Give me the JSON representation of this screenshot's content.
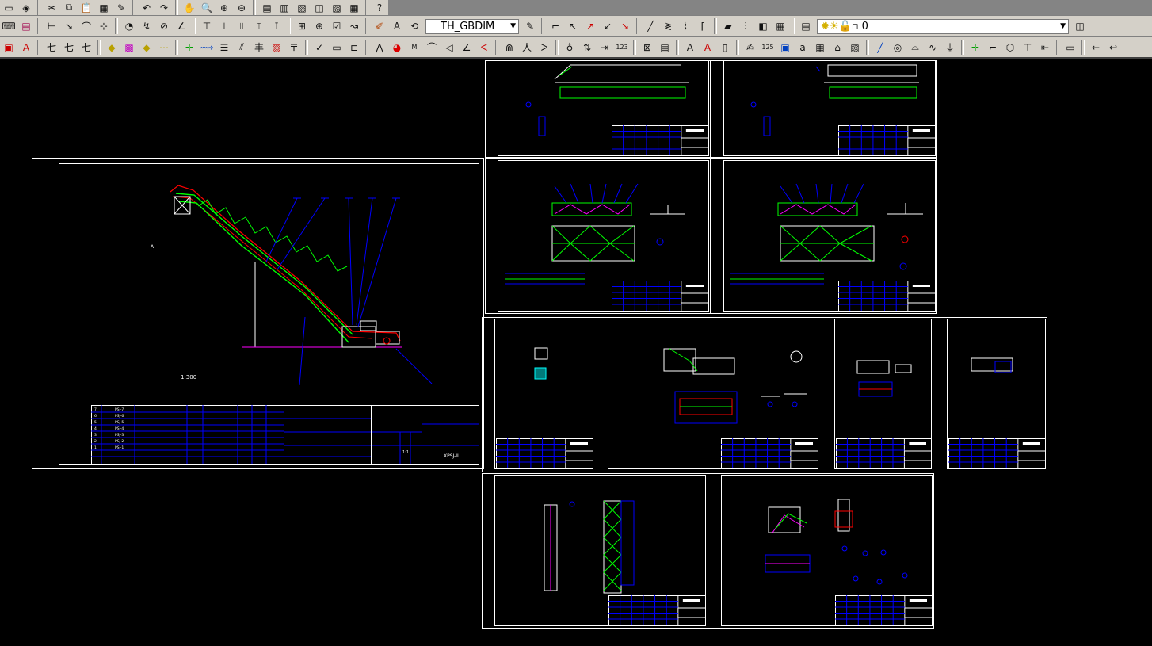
{
  "toolbar_top": {
    "icons": [
      "new-icon",
      "open-icon",
      "cut-icon",
      "copy-icon",
      "paste-icon",
      "match-properties-icon",
      "brush-icon",
      "undo-icon",
      "redo-icon",
      "pan-icon",
      "zoom-realtime-icon",
      "zoom-window-icon",
      "zoom-previous-icon",
      "properties-icon",
      "design-center-icon",
      "tool-palettes-icon",
      "sheet-set-icon",
      "markup-icon",
      "quick-calc-icon",
      "help-icon"
    ]
  },
  "toolbar_dim": {
    "dimstyle_value": "TH_GBDIM",
    "layer_value": "0"
  },
  "toolbar_draw": {
    "label_text": "A",
    "label_123": "123",
    "label_125": "125"
  },
  "drawing": {
    "main_sheet": {
      "scale_note": "1:300",
      "title_block_code": "XPSJ-II",
      "scale_value": "1:1",
      "bom_codes": [
        "PSJ-7",
        "PSJ-6",
        "PSJ-5",
        "PSJ-4",
        "PSJ-3",
        "PSJ-2",
        "PSJ-1"
      ],
      "bom_nums": [
        "7",
        "6",
        "5",
        "4",
        "3",
        "2",
        "1"
      ]
    }
  },
  "colors": {
    "background": "#000000",
    "sheet_border": "#ffffff",
    "annotation": "#0000ff",
    "structure": "#00ff00",
    "highlight": "#ff0000",
    "section": "#ff00ff"
  }
}
